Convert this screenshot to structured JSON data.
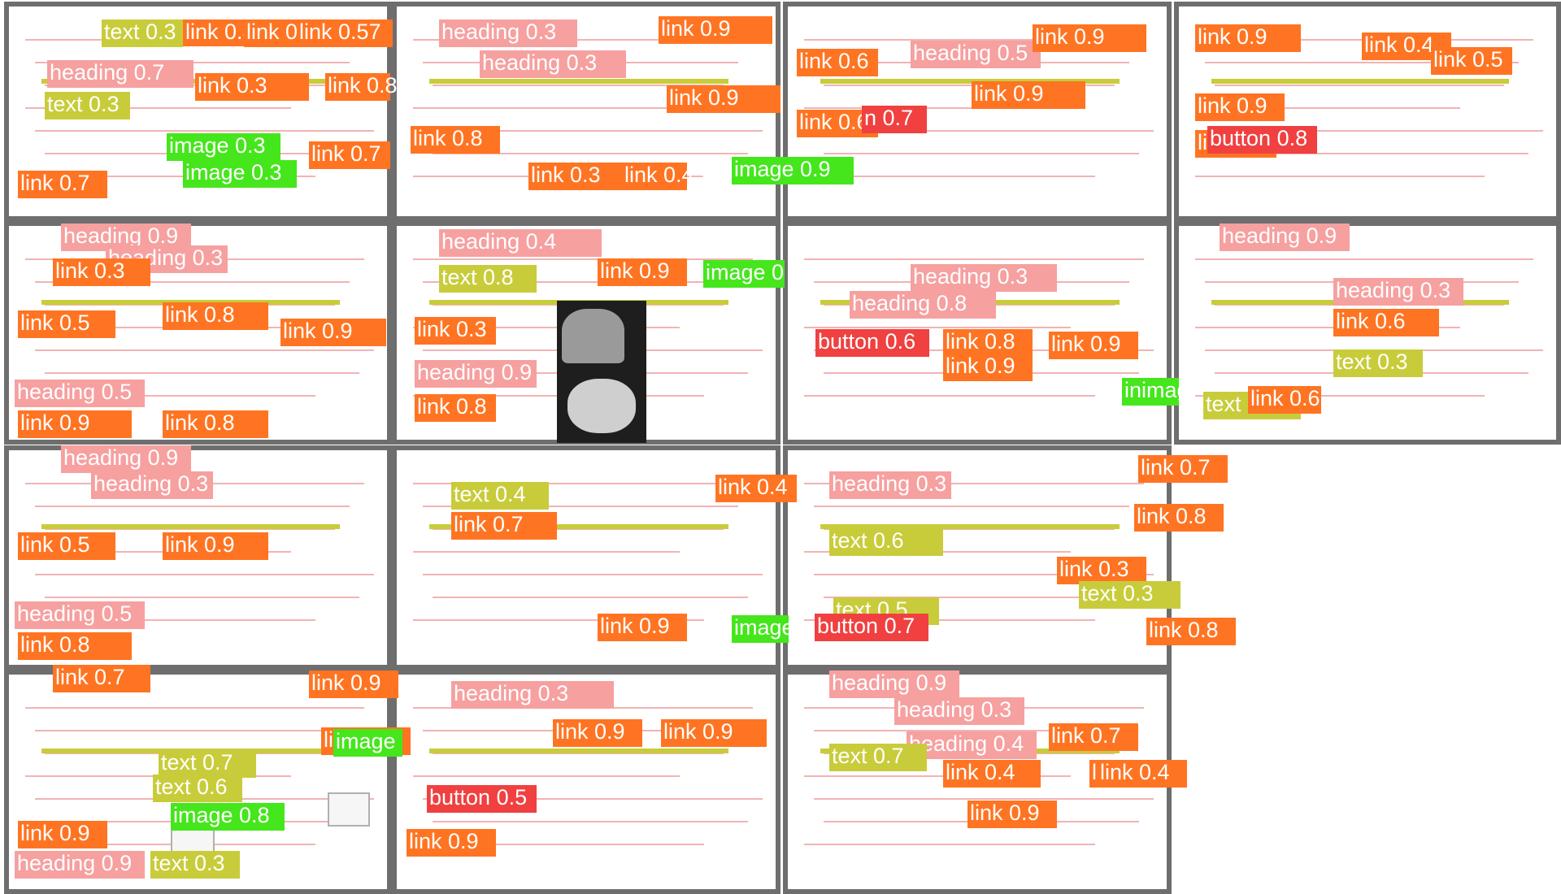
{
  "screen": {
    "title": ""
  },
  "colors": {
    "frame": "#6e6e6e",
    "link": "#ff7422",
    "heading": "#f6a0a0",
    "text": "#c8cc3a",
    "image": "#45e61c",
    "button": "#f04040",
    "background": "#ffffff"
  },
  "panels": [
    {
      "id": "p1"
    },
    {
      "id": "p2"
    },
    {
      "id": "p3"
    },
    {
      "id": "p4"
    },
    {
      "id": "p5"
    },
    {
      "id": "p6"
    },
    {
      "id": "p7"
    },
    {
      "id": "p8"
    },
    {
      "id": "p9"
    },
    {
      "id": "p10"
    },
    {
      "id": "p11"
    },
    {
      "id": "p12"
    },
    {
      "id": "p13"
    },
    {
      "id": "p14"
    }
  ],
  "detections": [
    {
      "label": "link 0.8",
      "type": "link"
    },
    {
      "label": "text 0.3",
      "type": "text"
    },
    {
      "label": "link 0.8",
      "type": "link"
    },
    {
      "label": "link 0.57",
      "type": "link"
    },
    {
      "label": "heading 0.7",
      "type": "heading"
    },
    {
      "label": "text 0.3",
      "type": "text"
    },
    {
      "label": "link 0.3",
      "type": "link"
    },
    {
      "label": "link 0.8",
      "type": "link"
    },
    {
      "label": "image 0.3",
      "type": "image"
    },
    {
      "label": "image 0.3",
      "type": "image"
    },
    {
      "label": "link 0.7",
      "type": "link"
    },
    {
      "label": "link 0.7",
      "type": "link"
    },
    {
      "label": "heading 0.3",
      "type": "heading"
    },
    {
      "label": "heading 0.3",
      "type": "heading"
    },
    {
      "label": "link 0.9",
      "type": "link"
    },
    {
      "label": "link 0.9",
      "type": "link"
    },
    {
      "label": "link 0.8",
      "type": "link"
    },
    {
      "label": "link 0.3",
      "type": "link"
    },
    {
      "label": "link 0.45",
      "type": "link"
    },
    {
      "label": "image 0.9",
      "type": "image"
    },
    {
      "label": "heading 0.5",
      "type": "heading"
    },
    {
      "label": "link 0.6",
      "type": "link"
    },
    {
      "label": "link 0.9",
      "type": "link"
    },
    {
      "label": "link 0.9",
      "type": "link"
    },
    {
      "label": "link 0.6",
      "type": "link"
    },
    {
      "label": "n 0.7",
      "type": "button"
    },
    {
      "label": "link 0.9",
      "type": "link"
    },
    {
      "label": "link 0.4",
      "type": "link"
    },
    {
      "label": "link 0.5",
      "type": "link"
    },
    {
      "label": "link 0.9",
      "type": "link"
    },
    {
      "label": "link 0.9",
      "type": "link"
    },
    {
      "label": "button 0.8",
      "type": "button"
    },
    {
      "label": "heading 0.9",
      "type": "heading"
    },
    {
      "label": "heading 0.3",
      "type": "heading"
    },
    {
      "label": "link 0.3",
      "type": "link"
    },
    {
      "label": "link 0.5",
      "type": "link"
    },
    {
      "label": "link 0.8",
      "type": "link"
    },
    {
      "label": "link 0.9",
      "type": "link"
    },
    {
      "label": "heading 0.5",
      "type": "heading"
    },
    {
      "label": "link 0.9",
      "type": "link"
    },
    {
      "label": "link 0.8",
      "type": "link"
    },
    {
      "label": "heading 0.4",
      "type": "heading"
    },
    {
      "label": "text 0.8",
      "type": "text"
    },
    {
      "label": "link 0.9",
      "type": "link"
    },
    {
      "label": "image 0",
      "type": "image"
    },
    {
      "label": "link 0.3",
      "type": "link"
    },
    {
      "label": "heading 0.9",
      "type": "heading"
    },
    {
      "label": "link 0.8",
      "type": "link"
    },
    {
      "label": "heading 0.3",
      "type": "heading"
    },
    {
      "label": "heading 0.8",
      "type": "heading"
    },
    {
      "label": "button 0.6",
      "type": "button"
    },
    {
      "label": "link 0.8",
      "type": "link"
    },
    {
      "label": "link 0.9",
      "type": "link"
    },
    {
      "label": "link 0.9",
      "type": "link"
    },
    {
      "label": "inimag",
      "type": "image"
    },
    {
      "label": "heading 0.9",
      "type": "heading"
    },
    {
      "label": "heading 0.3",
      "type": "heading"
    },
    {
      "label": "link 0.6",
      "type": "link"
    },
    {
      "label": "text 0.3",
      "type": "text"
    },
    {
      "label": "text 0.9",
      "type": "text"
    },
    {
      "label": "link 0.6",
      "type": "link"
    },
    {
      "label": "heading 0.9",
      "type": "heading"
    },
    {
      "label": "heading 0.3",
      "type": "heading"
    },
    {
      "label": "link 0.5",
      "type": "link"
    },
    {
      "label": "link 0.9",
      "type": "link"
    },
    {
      "label": "heading 0.5",
      "type": "heading"
    },
    {
      "label": "link 0.8",
      "type": "link"
    },
    {
      "label": "text 0.4",
      "type": "text"
    },
    {
      "label": "link 0.7",
      "type": "link"
    },
    {
      "label": "link 0.4",
      "type": "link"
    },
    {
      "label": "link 0.9",
      "type": "link"
    },
    {
      "label": "image",
      "type": "image"
    },
    {
      "label": "heading 0.3",
      "type": "heading"
    },
    {
      "label": "text 0.6",
      "type": "text"
    },
    {
      "label": "text 0.5",
      "type": "text"
    },
    {
      "label": "button 0.7",
      "type": "button"
    },
    {
      "label": "link 0.7",
      "type": "link"
    },
    {
      "label": "link 0.8",
      "type": "link"
    },
    {
      "label": "link 0.3",
      "type": "link"
    },
    {
      "label": "text 0.3",
      "type": "text"
    },
    {
      "label": "link 0.8",
      "type": "link"
    },
    {
      "label": "link 0.7",
      "type": "link"
    },
    {
      "label": "link 0.9",
      "type": "link"
    },
    {
      "label": "link 0.8",
      "type": "link"
    },
    {
      "label": "image",
      "type": "image"
    },
    {
      "label": "text 0.7",
      "type": "text"
    },
    {
      "label": "text 0.6",
      "type": "text"
    },
    {
      "label": "image 0.8",
      "type": "image"
    },
    {
      "label": "link 0.9",
      "type": "link"
    },
    {
      "label": "heading 0.9",
      "type": "heading"
    },
    {
      "label": "text 0.3",
      "type": "text"
    },
    {
      "label": "heading 0.3",
      "type": "heading"
    },
    {
      "label": "link 0.9",
      "type": "link"
    },
    {
      "label": "link 0.9",
      "type": "link"
    },
    {
      "label": "button 0.5",
      "type": "button"
    },
    {
      "label": "link 0.9",
      "type": "link"
    },
    {
      "label": "heading 0.9",
      "type": "heading"
    },
    {
      "label": "heading 0.3",
      "type": "heading"
    },
    {
      "label": "heading 0.4",
      "type": "heading"
    },
    {
      "label": "text 0.7",
      "type": "text"
    },
    {
      "label": "link 0.7",
      "type": "link"
    },
    {
      "label": "link 0.4",
      "type": "link"
    },
    {
      "label": "link 0.8",
      "type": "link"
    },
    {
      "label": "link 0.9",
      "type": "link"
    },
    {
      "label": "link 0.4",
      "type": "link"
    }
  ]
}
